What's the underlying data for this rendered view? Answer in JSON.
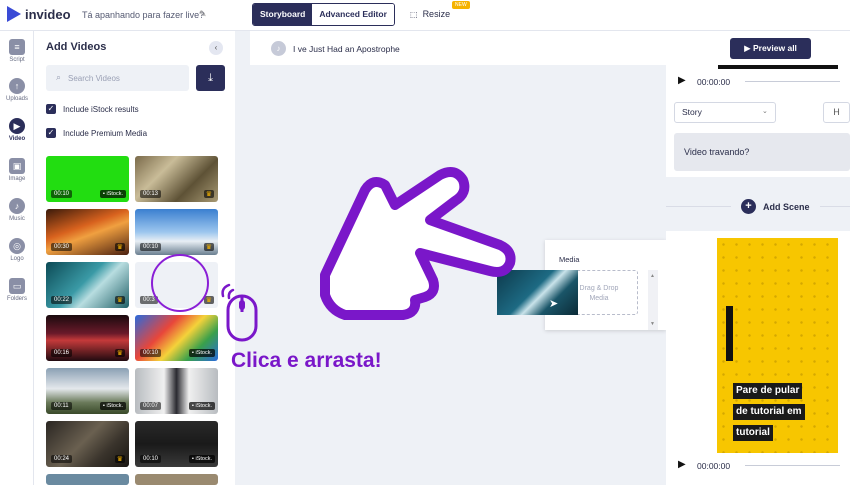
{
  "topbar": {
    "logo_text": "invideo",
    "project_title": "Tá apanhando para fazer live?",
    "mode_tabs": [
      "Storyboard",
      "Advanced Editor"
    ],
    "resize_label": "Resize",
    "new_badge": "NEW"
  },
  "rail": [
    {
      "label": "Script",
      "icon": "script-icon"
    },
    {
      "label": "Uploads",
      "icon": "upload-icon"
    },
    {
      "label": "Video",
      "icon": "video-icon"
    },
    {
      "label": "Image",
      "icon": "image-icon"
    },
    {
      "label": "Music",
      "icon": "music-icon"
    },
    {
      "label": "Logo",
      "icon": "logo-icon"
    },
    {
      "label": "Folders",
      "icon": "folder-icon"
    }
  ],
  "panel": {
    "title": "Add Videos",
    "search_placeholder": "Search Videos",
    "checkboxes": [
      "Include iStock results",
      "Include Premium Media"
    ]
  },
  "thumbnails": [
    {
      "duration": "00:10",
      "badge": "iStock"
    },
    {
      "duration": "00:13",
      "badge": "premium"
    },
    {
      "duration": "00:30",
      "badge": "premium"
    },
    {
      "duration": "00:10",
      "badge": "premium"
    },
    {
      "duration": "00:22",
      "badge": "premium"
    },
    {
      "duration": "00:3",
      "badge": "premium"
    },
    {
      "duration": "00:16",
      "badge": "premium"
    },
    {
      "duration": "00:10",
      "badge": "iStock"
    },
    {
      "duration": "00:11",
      "badge": "iStock"
    },
    {
      "duration": "00:07",
      "badge": "iStock"
    },
    {
      "duration": "00:24",
      "badge": "premium"
    },
    {
      "duration": "00:10",
      "badge": "iStock"
    }
  ],
  "editor": {
    "song_title": "I ve Just Had an Apostrophe",
    "preview_label": "Preview all",
    "add_scene_label": "Add Scene"
  },
  "scene1": {
    "time": "00:00:00",
    "layout_select": "Story",
    "h_button": "H",
    "script_text": "Video travando?"
  },
  "media_popup": {
    "title": "Media",
    "drop_text": "Drag & Drop Media"
  },
  "scene2": {
    "time": "00:00:00",
    "caption_lines": [
      "Pare de pular",
      "de tutorial em",
      "tutorial"
    ]
  },
  "overlay": {
    "cta_text": "Clica e arrasta!"
  },
  "colors": {
    "brand": "#2b2e5a",
    "accent_purple": "#7a17c9",
    "scene_yellow": "#f7c600"
  }
}
